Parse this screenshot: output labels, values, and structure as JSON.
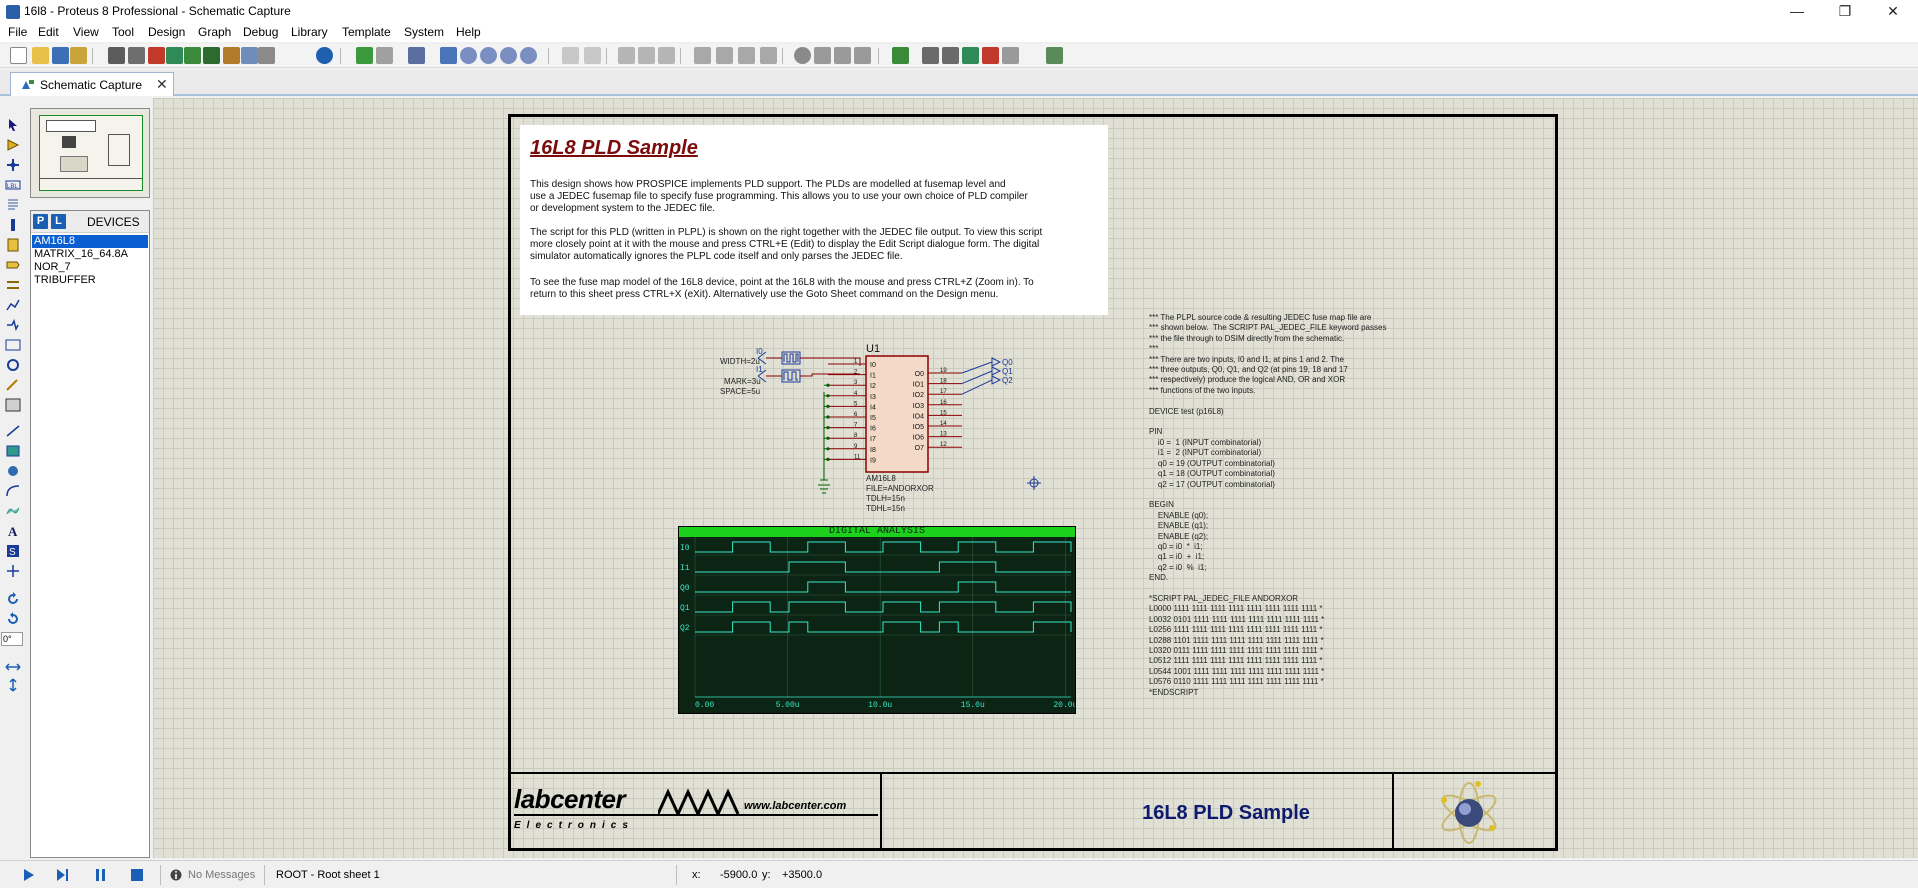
{
  "window": {
    "title": "16l8 - Proteus 8 Professional - Schematic Capture",
    "minimize": "—",
    "maximize": "❐",
    "close": "✕"
  },
  "menu": [
    "File",
    "Edit",
    "View",
    "Tool",
    "Design",
    "Graph",
    "Debug",
    "Library",
    "Template",
    "System",
    "Help"
  ],
  "tab": {
    "label": "Schematic Capture",
    "close": "✕"
  },
  "devices": {
    "p_button": "P",
    "l_button": "L",
    "header": "DEVICES",
    "items": [
      "AM16L8",
      "MATRIX_16_64.8A",
      "NOR_7",
      "TRIBUFFER"
    ],
    "selected": 0
  },
  "left": {
    "rotation": "0°"
  },
  "description": {
    "title": "16L8 PLD Sample",
    "p1": [
      "This design shows how PROSPICE implements PLD support. The PLDs are modelled at fusemap level and",
      "use a JEDEC fusemap file to specify fuse programming. This allows you to use your own choice of PLD compiler",
      "or development system to the JEDEC file."
    ],
    "p2": [
      "The script for this PLD (written in PLPL) is shown on the right together with the JEDEC file output. To view this script",
      "more closely point at it with the mouse and press CTRL+E (Edit) to display the Edit Script dialogue form. The digital",
      "simulator automatically ignores the PLPL code itself and only parses the JEDEC file."
    ],
    "p3": [
      "To see the fuse map model of the 16L8 device, point at the 16L8 with the mouse and press CTRL+Z (Zoom in). To",
      "return to this sheet press CTRL+X (eXit). Alternatively use the Goto Sheet command on the Design menu."
    ]
  },
  "script_text": "*** The PLPL source code & resulting JEDEC fuse map file are\n*** shown below.  The SCRIPT PAL_JEDEC_FILE keyword passes\n*** the file through to DSIM directly from the schematic.\n***\n*** There are two inputs, I0 and I1, at pins 1 and 2. The\n*** three outputs, Q0, Q1, and Q2 (at pins 19, 18 and 17\n*** respectively) produce the logical AND, OR and XOR\n*** functions of the two inputs.\n\nDEVICE test (p16L8)\n\nPIN\n    i0 =  1 (INPUT combinatorial)\n    i1 =  2 (INPUT combinatorial)\n    q0 = 19 (OUTPUT combinatorial)\n    q1 = 18 (OUTPUT combinatorial)\n    q2 = 17 (OUTPUT combinatorial)\n\nBEGIN\n    ENABLE (q0);\n    ENABLE (q1);\n    ENABLE (q2);\n    q0 = i0  *  i1;\n    q1 = i0  +  i1;\n    q2 = i0  %  i1;\nEND.\n\n*SCRIPT PAL_JEDEC_FILE ANDORXOR\nL0000 1111 1111 1111 1111 1111 1111 1111 1111 *\nL0032 0101 1111 1111 1111 1111 1111 1111 1111 *\nL0256 1111 1111 1111 1111 1111 1111 1111 1111 *\nL0288 1101 1111 1111 1111 1111 1111 1111 1111 *\nL0320 0111 1111 1111 1111 1111 1111 1111 1111 *\nL0512 1111 1111 1111 1111 1111 1111 1111 1111 *\nL0544 1001 1111 1111 1111 1111 1111 1111 1111 *\nL0576 0110 1111 1111 1111 1111 1111 1111 1111 *\n*ENDSCRIPT",
  "schematic": {
    "ref": "U1",
    "part": "AM16L8",
    "file": "FILE=ANDORXOR",
    "tdlh": "TDLH=15n",
    "tdhl": "TDHL=15n",
    "gen_i0": {
      "label": "I0",
      "param": "WIDTH=2u"
    },
    "gen_i1": {
      "label": "I1",
      "param1": "MARK=3u",
      "param2": "SPACE=5u"
    },
    "inputs": [
      "I0",
      "I1",
      "I2",
      "I3",
      "I4",
      "I5",
      "I6",
      "I7",
      "I8",
      "I9"
    ],
    "input_pins": [
      "1",
      "2",
      "3",
      "4",
      "5",
      "6",
      "7",
      "8",
      "9",
      "11"
    ],
    "outputs": [
      "O0",
      "IO1",
      "IO2",
      "IO3",
      "IO4",
      "IO5",
      "IO6",
      "O7"
    ],
    "output_pins": [
      "19",
      "18",
      "17",
      "16",
      "15",
      "14",
      "13",
      "12"
    ],
    "probes": [
      "Q0",
      "Q1",
      "Q2"
    ]
  },
  "analysis": {
    "title": "DIGITAL ANALYSIS",
    "traces": [
      "I0",
      "I1",
      "Q0",
      "Q1",
      "Q2"
    ],
    "ticks": [
      "0.00",
      "5.00u",
      "10.0u",
      "15.0u",
      "20.0u"
    ]
  },
  "title_block": {
    "logo_text": "labcenter",
    "logo_sub": "Electronics",
    "url": "www.labcenter.com",
    "title": "16L8 PLD Sample"
  },
  "status": {
    "messages": "No Messages",
    "sheet": "ROOT - Root sheet 1",
    "x_label": "x:",
    "x_value": "-5900.0",
    "y_label": "y:",
    "y_value": "+3500.0"
  },
  "colors": {
    "accent": "#0a5fd0",
    "canvas": "#e1e0d5",
    "chip_fill": "#f2d9c8",
    "chip_border": "#8b0000",
    "wire": "#006000",
    "trace": "#38e8c8"
  }
}
